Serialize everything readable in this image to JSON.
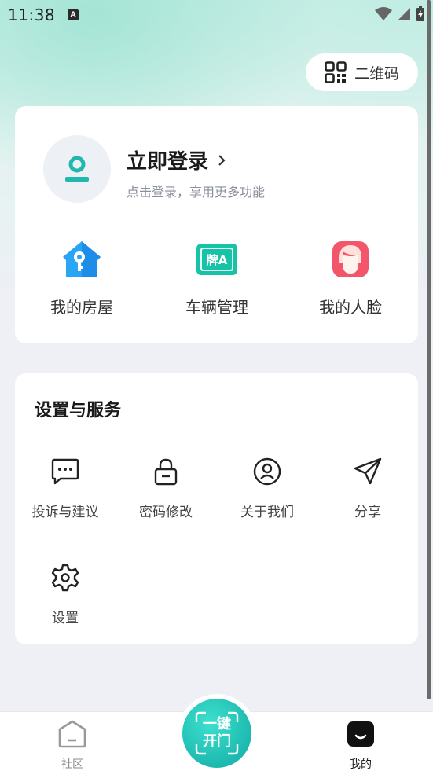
{
  "status_bar": {
    "time": "11:38",
    "notification_badge": "A"
  },
  "qr_button": {
    "label": "二维码",
    "icon": "qr-code-icon"
  },
  "profile": {
    "title": "立即登录",
    "subtitle": "点击登录，享用更多功能",
    "quick_actions": [
      {
        "label": "我的房屋",
        "icon": "house-key-icon"
      },
      {
        "label": "车辆管理",
        "icon": "license-plate-icon"
      },
      {
        "label": "我的人脸",
        "icon": "face-icon"
      }
    ],
    "plate_text": "牌A"
  },
  "services": {
    "title": "设置与服务",
    "items": [
      {
        "label": "投诉与建议",
        "icon": "message-dots-icon"
      },
      {
        "label": "密码修改",
        "icon": "lock-icon"
      },
      {
        "label": "关于我们",
        "icon": "user-circle-icon"
      },
      {
        "label": "分享",
        "icon": "paper-plane-icon"
      },
      {
        "label": "设置",
        "icon": "gear-icon"
      }
    ]
  },
  "bottom_nav": {
    "left": {
      "label": "社区",
      "icon": "home-icon"
    },
    "center": {
      "line1": "一键",
      "line2": "开门"
    },
    "right": {
      "label": "我的",
      "icon": "profile-smile-icon"
    }
  },
  "colors": {
    "accent": "#23c2b6",
    "active_nav": "#1a1a1a",
    "inactive_nav": "#888888"
  }
}
